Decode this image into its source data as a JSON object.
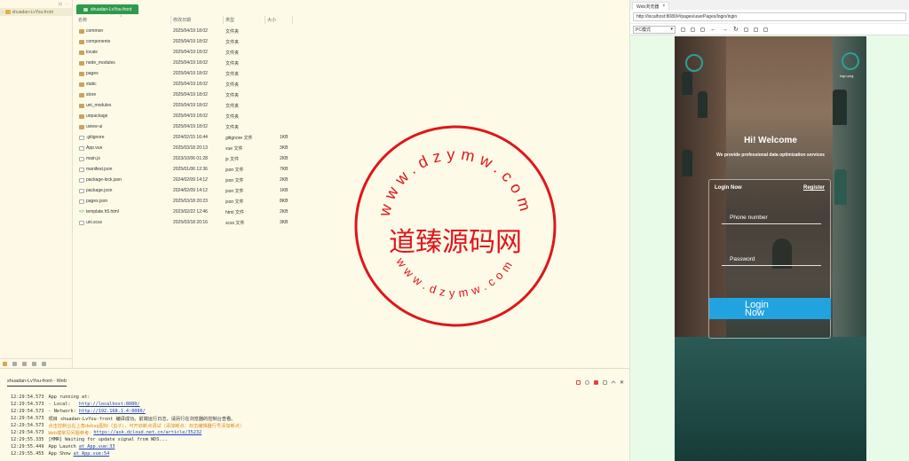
{
  "project_tree": {
    "item": "shuadan-LvYou-front"
  },
  "file_tab": {
    "label": "shuadan-LvYou-front"
  },
  "file_table": {
    "headers": {
      "name": "名称",
      "date": "修改日期",
      "type": "类型",
      "size": "大小"
    },
    "rows": [
      {
        "icon": "folder",
        "name": "common",
        "date": "2025/04/19 18:02",
        "type": "文件夹",
        "size": ""
      },
      {
        "icon": "folder",
        "name": "components",
        "date": "2025/04/19 18:02",
        "type": "文件夹",
        "size": ""
      },
      {
        "icon": "folder",
        "name": "locale",
        "date": "2025/04/19 18:02",
        "type": "文件夹",
        "size": ""
      },
      {
        "icon": "folder",
        "name": "node_modules",
        "date": "2025/04/19 18:02",
        "type": "文件夹",
        "size": ""
      },
      {
        "icon": "folder",
        "name": "pages",
        "date": "2025/04/19 18:02",
        "type": "文件夹",
        "size": ""
      },
      {
        "icon": "folder",
        "name": "static",
        "date": "2025/04/19 18:02",
        "type": "文件夹",
        "size": ""
      },
      {
        "icon": "folder",
        "name": "store",
        "date": "2025/04/19 18:02",
        "type": "文件夹",
        "size": ""
      },
      {
        "icon": "folder",
        "name": "uni_modules",
        "date": "2025/04/19 18:02",
        "type": "文件夹",
        "size": ""
      },
      {
        "icon": "folder",
        "name": "unpackage",
        "date": "2025/04/19 18:02",
        "type": "文件夹",
        "size": ""
      },
      {
        "icon": "folder",
        "name": "uview-ui",
        "date": "2025/04/19 18:02",
        "type": "文件夹",
        "size": ""
      },
      {
        "icon": "file",
        "name": ".gitignore",
        "date": "2024/02/15 16:44",
        "type": "gitignore 文件",
        "size": "1KB"
      },
      {
        "icon": "file",
        "name": "App.vue",
        "date": "2025/03/18 20:13",
        "type": "vue 文件",
        "size": "3KB"
      },
      {
        "icon": "file",
        "name": "main.js",
        "date": "2023/10/06 01:28",
        "type": "js 文件",
        "size": "2KB"
      },
      {
        "icon": "file",
        "name": "manifest.json",
        "date": "2025/01/06 12:36",
        "type": "json 文件",
        "size": "7KB"
      },
      {
        "icon": "file",
        "name": "package-lock.json",
        "date": "2024/02/09 14:12",
        "type": "json 文件",
        "size": "2KB"
      },
      {
        "icon": "file",
        "name": "package.json",
        "date": "2024/02/09 14:12",
        "type": "json 文件",
        "size": "1KB"
      },
      {
        "icon": "file",
        "name": "pages.json",
        "date": "2025/03/18 20:23",
        "type": "json 文件",
        "size": "8KB"
      },
      {
        "icon": "code",
        "name": "template.h5.html",
        "date": "2023/02/22 12:46",
        "type": "html 文件",
        "size": "2KB"
      },
      {
        "icon": "file",
        "name": "uni.scss",
        "date": "2025/03/18 20:16",
        "type": "scss 文件",
        "size": "3KB"
      }
    ]
  },
  "browser": {
    "tab_label": "Web浏览器",
    "url": "http://localhost:8080/#/pages/userPages/login/login",
    "device_select": "PC模式"
  },
  "app": {
    "logo_right_label": "logo.png",
    "welcome": "Hi! Welcome",
    "subtitle": "We provide professional data optimization services",
    "card_title": "Login Now",
    "register": "Register",
    "phone_placeholder": "Phone number",
    "password_placeholder": "Password",
    "login_button_line1": "Login",
    "login_button_line2": "Now"
  },
  "console": {
    "title": "shuadan-LvYou-front - Web",
    "logs": [
      {
        "time": "12:29:54.573",
        "text": "App running at:",
        "link": "",
        "orange": false
      },
      {
        "time": "12:29:54.573",
        "text": "- Local:   ",
        "link": "http://localhost:8080/",
        "orange": false
      },
      {
        "time": "12:29:54.573",
        "text": "- Network: ",
        "link": "http://192.168.1.4:8080/",
        "orange": false
      },
      {
        "time": "12:29:54.573",
        "text": "项目 shuadan-LvYou-front 编译成功。前端运行日志，请另行在浏览器的控制台查看。",
        "link": "",
        "orange": false
      },
      {
        "time": "12:29:54.573",
        "text": "点击控制台右上角debug图标（虫子），可开启断点调试（添加断点：双击编辑器行号添加断点）",
        "link": "",
        "orange": true
      },
      {
        "time": "12:29:54.573",
        "text": "Web端常见问题参考：",
        "link": "https://ask.dcloud.net.cn/article/35232",
        "orange": true
      },
      {
        "time": "12:29:55.335",
        "text": "[HMR] Waiting for update signal from WDS...",
        "link": "",
        "orange": false
      },
      {
        "time": "12:29:55.449",
        "text": "App Launch ",
        "link": "at App.vue:33",
        "orange": false
      },
      {
        "time": "12:29:55.455",
        "text": "App Show ",
        "link": "at App.vue:54",
        "orange": false
      }
    ]
  },
  "watermark": {
    "text": "道臻源码网",
    "top_arc": "www.dzymw.com",
    "bottom_arc": "www.dzymw.com"
  }
}
